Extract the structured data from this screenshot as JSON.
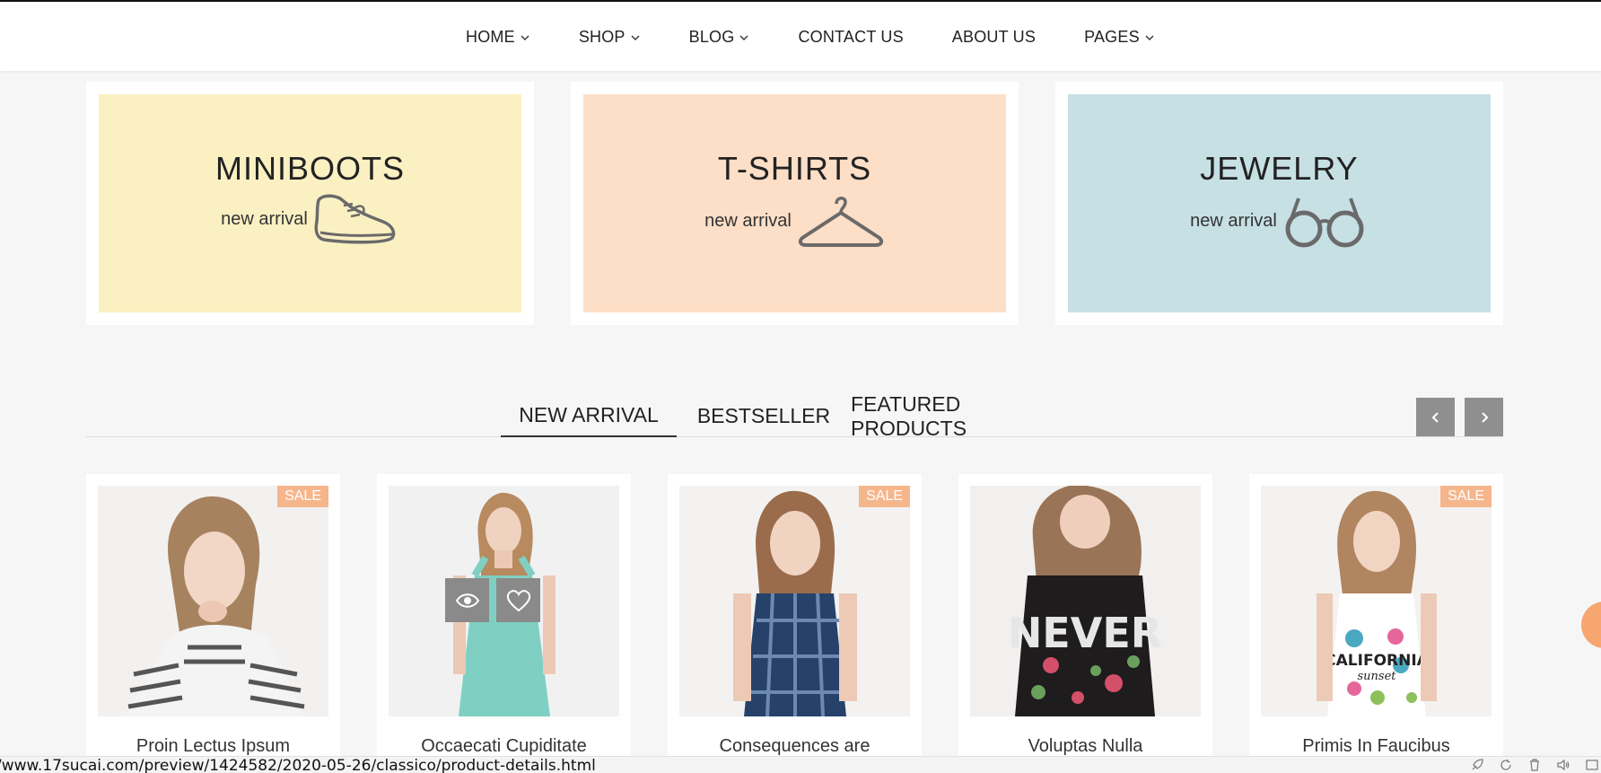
{
  "nav": {
    "items": [
      {
        "label": "HOME",
        "has_dropdown": true
      },
      {
        "label": "SHOP",
        "has_dropdown": true
      },
      {
        "label": "BLOG",
        "has_dropdown": true
      },
      {
        "label": "CONTACT US",
        "has_dropdown": false
      },
      {
        "label": "ABOUT US",
        "has_dropdown": false
      },
      {
        "label": "PAGES",
        "has_dropdown": true
      }
    ]
  },
  "banners": [
    {
      "title": "MINIBOOTS",
      "subtitle": "new arrival",
      "icon": "shoe-icon",
      "bg": "#fbf0c2"
    },
    {
      "title": "T-SHIRTS",
      "subtitle": "new arrival",
      "icon": "hanger-icon",
      "bg": "#fddec6"
    },
    {
      "title": "JEWELRY",
      "subtitle": "new arrival",
      "icon": "glasses-icon",
      "bg": "#c6e0e4"
    }
  ],
  "tabs": {
    "items": [
      "NEW ARRIVAL",
      "BESTSELLER",
      "FEATURED PRODUCTS"
    ],
    "active": "NEW ARRIVAL",
    "prev_icon": "chevron-left-icon",
    "next_icon": "chevron-right-icon"
  },
  "products": [
    {
      "title": "Proin Lectus Ipsum",
      "badge": "SALE"
    },
    {
      "title": "Occaecati Cupiditate",
      "badge": ""
    },
    {
      "title": "Consequences are",
      "badge": "SALE"
    },
    {
      "title": "Voluptas Nulla",
      "badge": ""
    },
    {
      "title": "Primis In Faucibus",
      "badge": "SALE"
    }
  ],
  "product_image_text": {
    "never": "NEVER",
    "california": "CALIFORNIA",
    "sunset": "sunset"
  },
  "quick_actions": {
    "view_icon": "eye-icon",
    "wishlist_icon": "heart-icon"
  },
  "status": {
    "url": "/www.17sucai.com/preview/1424582/2020-05-26/classico/product-details.html"
  },
  "colors": {
    "sale_badge": "#f6b68c",
    "arrow_button": "#8f8f8f",
    "accent_fab": "#f6a66e"
  }
}
